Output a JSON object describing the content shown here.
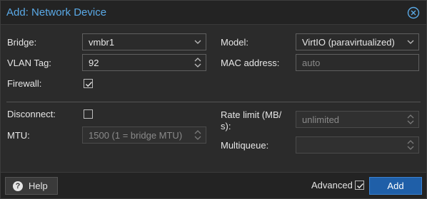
{
  "dialog": {
    "title": "Add: Network Device"
  },
  "left": {
    "bridge": {
      "label": "Bridge:",
      "value": "vmbr1"
    },
    "vlan": {
      "label": "VLAN Tag:",
      "value": "92"
    },
    "firewall": {
      "label": "Firewall:",
      "checked": true
    },
    "disconnect": {
      "label": "Disconnect:",
      "checked": false
    },
    "mtu": {
      "label": "MTU:",
      "placeholder": "1500 (1 = bridge MTU)"
    }
  },
  "right": {
    "model": {
      "label": "Model:",
      "value": "VirtIO (paravirtualized)"
    },
    "mac": {
      "label": "MAC address:",
      "placeholder": "auto"
    },
    "rate_limit": {
      "label_line1": "Rate limit (MB/",
      "label_line2": "s):",
      "placeholder": "unlimited"
    },
    "multiqueue": {
      "label": "Multiqueue:",
      "value": ""
    }
  },
  "footer": {
    "help_label": "Help",
    "advanced_label": "Advanced",
    "advanced_checked": true,
    "add_label": "Add"
  },
  "colors": {
    "accent": "#5aa9e6",
    "primary_button": "#1f5fa8"
  },
  "icons": {
    "close": "circle-x-icon",
    "help": "question-circle-icon",
    "dropdown": "chevron-down-icon",
    "spinner": "up-down-spinner-icon",
    "check": "check-icon"
  }
}
